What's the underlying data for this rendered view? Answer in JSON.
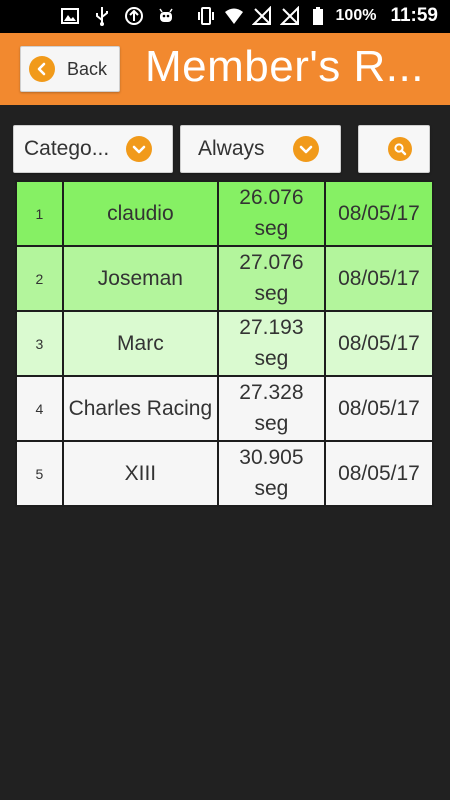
{
  "status_bar": {
    "battery": "100%",
    "time": "11:59",
    "icons": [
      "image-icon",
      "usb-icon",
      "upload-icon",
      "android-icon",
      "vibrate-icon",
      "wifi-icon",
      "no-signal-icon",
      "no-signal-icon",
      "battery-icon"
    ]
  },
  "header": {
    "back_label": "Back",
    "title": "Member's R..."
  },
  "filters": {
    "category_label": "Catego...",
    "period_label": "Always",
    "search_icon": "search-icon"
  },
  "ranking": {
    "rows": [
      {
        "position": "1",
        "name": "claudio",
        "time": "26.076",
        "unit": "seg",
        "date": "08/05/17"
      },
      {
        "position": "2",
        "name": "Joseman",
        "time": "27.076",
        "unit": "seg",
        "date": "08/05/17"
      },
      {
        "position": "3",
        "name": "Marc",
        "time": "27.193",
        "unit": "seg",
        "date": "08/05/17"
      },
      {
        "position": "4",
        "name": "Charles Racing",
        "time": "27.328",
        "unit": "seg",
        "date": "08/05/17"
      },
      {
        "position": "5",
        "name": "XIII",
        "time": "30.905",
        "unit": "seg",
        "date": "08/05/17"
      }
    ]
  },
  "colors": {
    "accent": "#f2892f",
    "icon_orange": "#f19a1a",
    "row1": "#86f064",
    "row2": "#b3f59c",
    "row3": "#dafad0",
    "row_default": "#f6f6f6",
    "background": "#212121"
  }
}
